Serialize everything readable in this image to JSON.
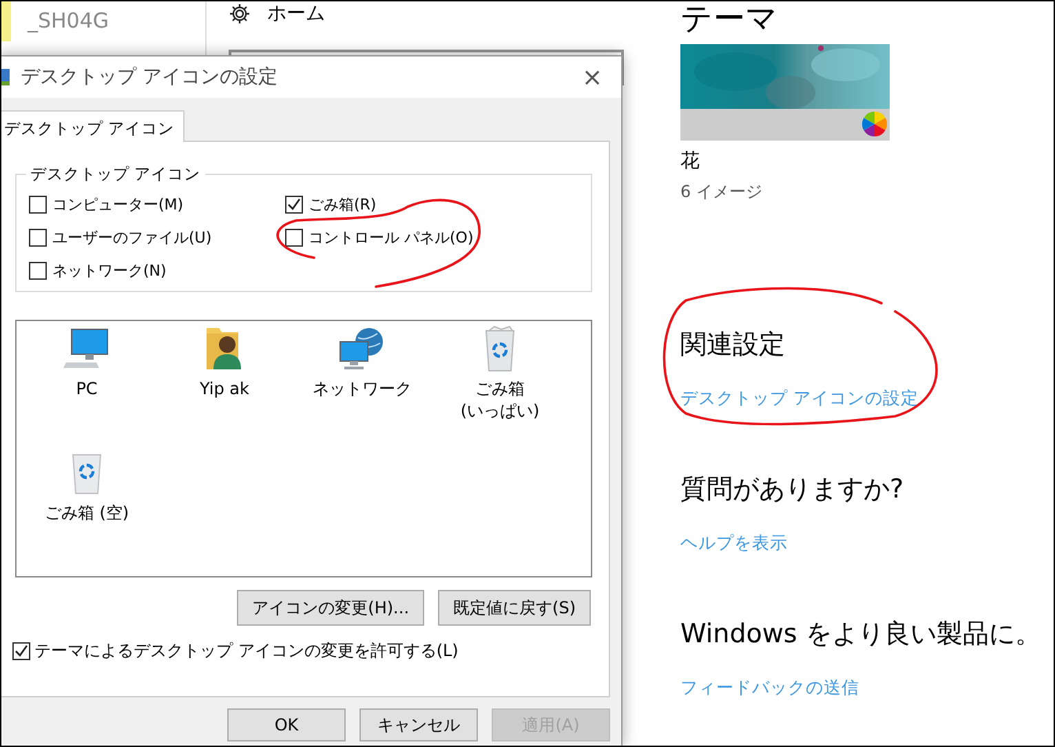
{
  "explorer": {
    "item": "_SH04G"
  },
  "settings": {
    "nav_item": "ホーム",
    "title": "テーマ",
    "theme": {
      "name": "花",
      "count": "6 イメージ"
    },
    "sections": [
      {
        "heading": "関連設定",
        "link": "デスクトップ アイコンの設定"
      },
      {
        "heading": "質問がありますか?",
        "link": "ヘルプを表示"
      },
      {
        "heading": "Windows をより良い製品に。",
        "link": "フィードバックの送信"
      }
    ]
  },
  "dialog": {
    "title": "デスクトップ アイコンの設定",
    "close": "×",
    "tabs": [
      {
        "label": "デスクトップ アイコン",
        "selected": true
      }
    ],
    "group_label": "デスクトップ アイコン",
    "options": [
      {
        "label": "コンピューター(M)",
        "checked": false
      },
      {
        "label": "ごみ箱(R)",
        "checked": true
      },
      {
        "label": "ユーザーのファイル(U)",
        "checked": false
      },
      {
        "label": "コントロール パネル(O)",
        "checked": false
      },
      {
        "label": "ネットワーク(N)",
        "checked": false
      }
    ],
    "icons": [
      {
        "label": "PC",
        "kind": "monitor"
      },
      {
        "label": "Yip ak",
        "kind": "user"
      },
      {
        "label": "ネットワーク",
        "kind": "network"
      },
      {
        "label": "ごみ箱\n(いっぱい)",
        "kind": "bin-full"
      },
      {
        "label": "ごみ箱 (空)",
        "kind": "bin-empty"
      }
    ],
    "buttons": [
      "アイコンの変更(H)...",
      "既定値に戻す(S)"
    ],
    "allow_themes": {
      "label": "テーマによるデスクトップ アイコンの変更を許可する(L)",
      "checked": true
    },
    "footer_buttons": [
      {
        "label": "OK",
        "disabled": false
      },
      {
        "label": "キャンセル",
        "disabled": false
      },
      {
        "label": "適用(A)",
        "disabled": true
      }
    ]
  }
}
